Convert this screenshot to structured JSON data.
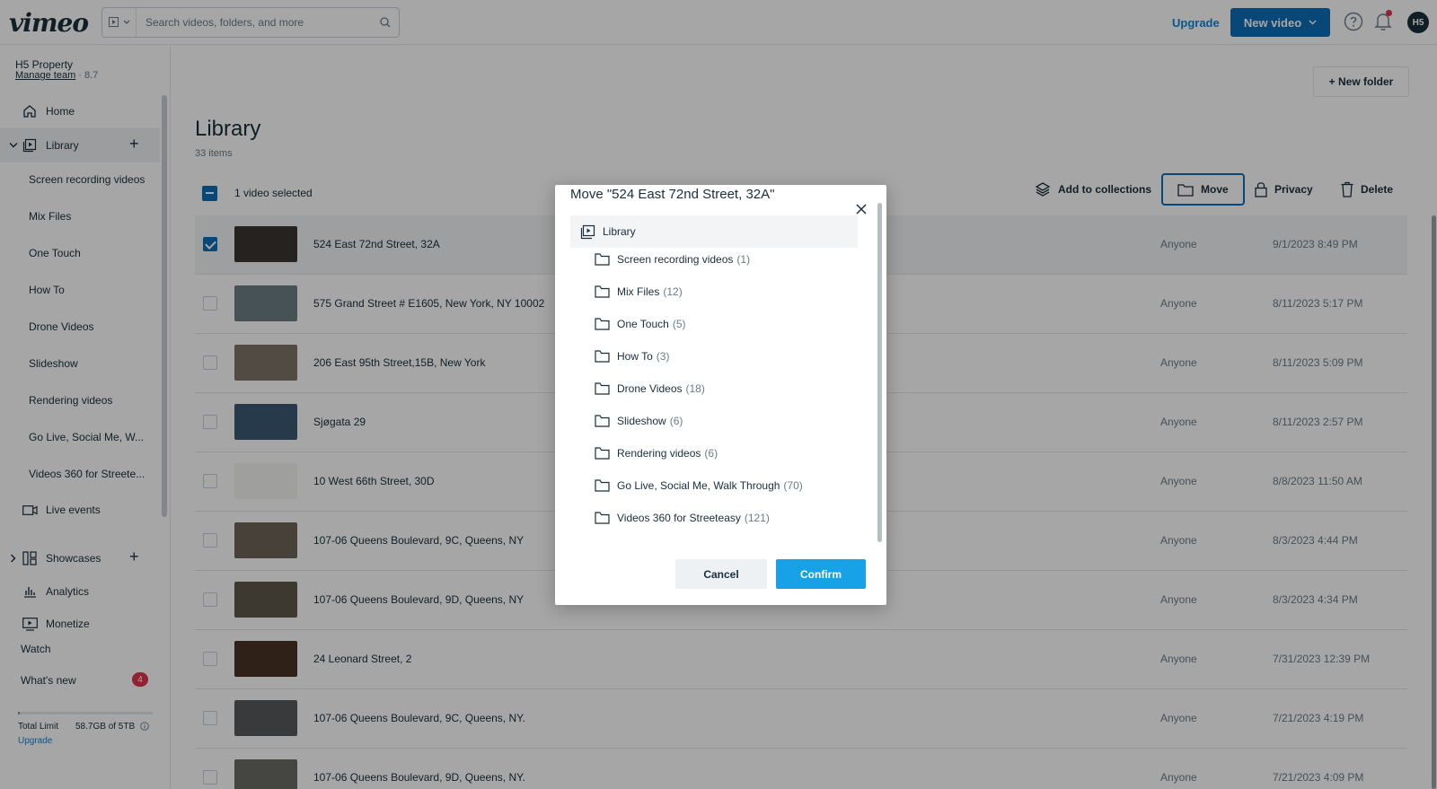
{
  "topbar": {
    "logo": "vimeo",
    "search_placeholder": "Search videos, folders, and more",
    "upgrade_label": "Upgrade",
    "new_video_label": "New video",
    "avatar_initials": "H5"
  },
  "sidebar": {
    "team_name": "H5 Property",
    "manage_team": "Manage team",
    "team_suffix": "· 8.7",
    "home": "Home",
    "library": "Library",
    "folders": [
      "Screen recording videos",
      "Mix Files",
      "One Touch",
      "How To",
      "Drone Videos",
      "Slideshow",
      "Rendering videos",
      "Go Live, Social Me, W...",
      "Videos 360 for Streete..."
    ],
    "live_events": "Live events",
    "showcases": "Showcases",
    "analytics": "Analytics",
    "monetize": "Monetize",
    "watch": "Watch",
    "whats_new": "What's new",
    "whats_new_badge": "4",
    "storage_label": "Total Limit",
    "storage_value": "58.7GB of 5TB",
    "storage_used_fraction": 0.012,
    "storage_upgrade": "Upgrade"
  },
  "main": {
    "new_folder_label": "+ New folder",
    "title": "Library",
    "item_count": "33 items",
    "selected_label": "1 video selected",
    "actions": {
      "add_to_collections": "Add to collections",
      "move": "Move",
      "privacy": "Privacy",
      "delete": "Delete"
    },
    "rows": [
      {
        "name": "524 East 72nd Street, 32A",
        "privacy": "Anyone",
        "date": "9/1/2023 8:49 PM",
        "selected": true,
        "thumb": "#3a3530"
      },
      {
        "name": "575 Grand Street # E1605, New York, NY 10002",
        "privacy": "Anyone",
        "date": "8/11/2023 5:17 PM",
        "selected": false,
        "thumb": "#6d7f86"
      },
      {
        "name": "206 East 95th Street,15B, New York",
        "privacy": "Anyone",
        "date": "8/11/2023 5:09 PM",
        "selected": false,
        "thumb": "#7d7468"
      },
      {
        "name": "Sjøgata 29",
        "privacy": "Anyone",
        "date": "8/11/2023 2:57 PM",
        "selected": false,
        "thumb": "#3b5a74"
      },
      {
        "name": "10 West 66th Street, 30D",
        "privacy": "Anyone",
        "date": "8/8/2023 11:50 AM",
        "selected": false,
        "thumb": "#f4f4f2"
      },
      {
        "name": "107-06 Queens Boulevard, 9C, Queens, NY",
        "privacy": "Anyone",
        "date": "8/3/2023 4:44 PM",
        "selected": false,
        "thumb": "#6e6558"
      },
      {
        "name": "107-06 Queens Boulevard, 9D, Queens, NY",
        "privacy": "Anyone",
        "date": "8/3/2023 4:34 PM",
        "selected": false,
        "thumb": "#5e564a"
      },
      {
        "name": "24 Leonard Street, 2",
        "privacy": "Anyone",
        "date": "7/31/2023 12:39 PM",
        "selected": false,
        "thumb": "#4a3426"
      },
      {
        "name": "107-06 Queens Boulevard, 9C, Queens, NY.",
        "privacy": "Anyone",
        "date": "7/21/2023 4:19 PM",
        "selected": false,
        "thumb": "#585a5c"
      },
      {
        "name": "107-06 Queens Boulevard, 9D, Queens, NY.",
        "privacy": "Anyone",
        "date": "7/21/2023 4:09 PM",
        "selected": false,
        "thumb": "#6a6a64"
      }
    ]
  },
  "modal": {
    "title": "Move \"524 East 72nd Street, 32A\"",
    "root": "Library",
    "folders": [
      {
        "name": "Screen recording videos",
        "count": "(1)"
      },
      {
        "name": "Mix Files",
        "count": "(12)"
      },
      {
        "name": "One Touch",
        "count": "(5)"
      },
      {
        "name": "How To",
        "count": "(3)"
      },
      {
        "name": "Drone Videos",
        "count": "(18)"
      },
      {
        "name": "Slideshow",
        "count": "(6)"
      },
      {
        "name": "Rendering videos",
        "count": "(6)"
      },
      {
        "name": "Go Live, Social Me, Walk Through",
        "count": "(70)"
      },
      {
        "name": "Videos 360 for Streeteasy",
        "count": "(121)"
      }
    ],
    "cancel_label": "Cancel",
    "confirm_label": "Confirm"
  },
  "colors": {
    "brand_blue": "#0d6fb8",
    "confirm_blue": "#17a2e8",
    "link_blue": "#0e87d9",
    "badge_red": "#e0334c"
  }
}
